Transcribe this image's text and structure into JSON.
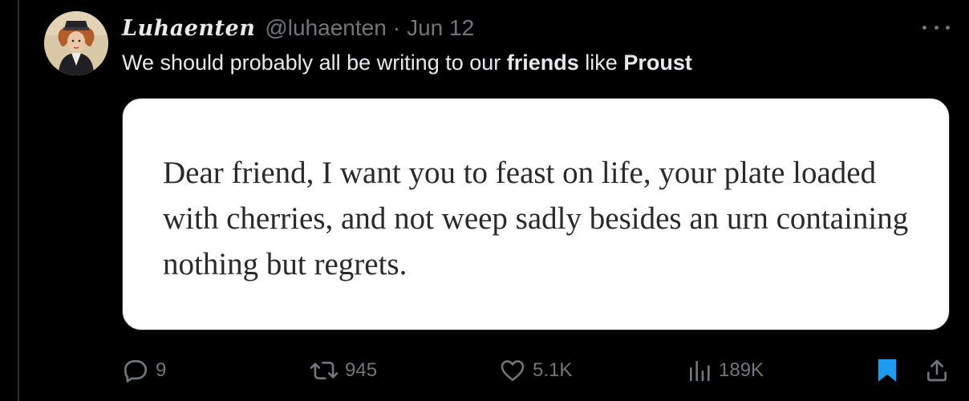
{
  "tweet": {
    "display_name": "Luhaenten",
    "handle": "@luhaenten",
    "separator": "·",
    "date": "Jun 12",
    "text_parts": [
      "We should probably all be writing to our ",
      "friends",
      " like ",
      "Proust"
    ],
    "media_quote": "Dear friend, I want you to feast on life, your plate loaded with cherries, and not weep sadly besides an urn containing nothing but regrets."
  },
  "actions": {
    "replies": "9",
    "reposts": "945",
    "likes": "5.1K",
    "views": "189K"
  },
  "icons": {
    "more": "more-horizontal-icon",
    "reply": "reply-bubble-icon",
    "repost": "repost-arrows-icon",
    "like": "heart-icon",
    "views": "views-bar-chart-icon",
    "bookmark": "bookmark-icon",
    "share": "share-upload-icon"
  },
  "colors": {
    "background": "#000000",
    "text": "#e7e9ea",
    "muted": "#71767b",
    "bookmark_active": "#1d9bf0",
    "card": "#ffffff"
  }
}
